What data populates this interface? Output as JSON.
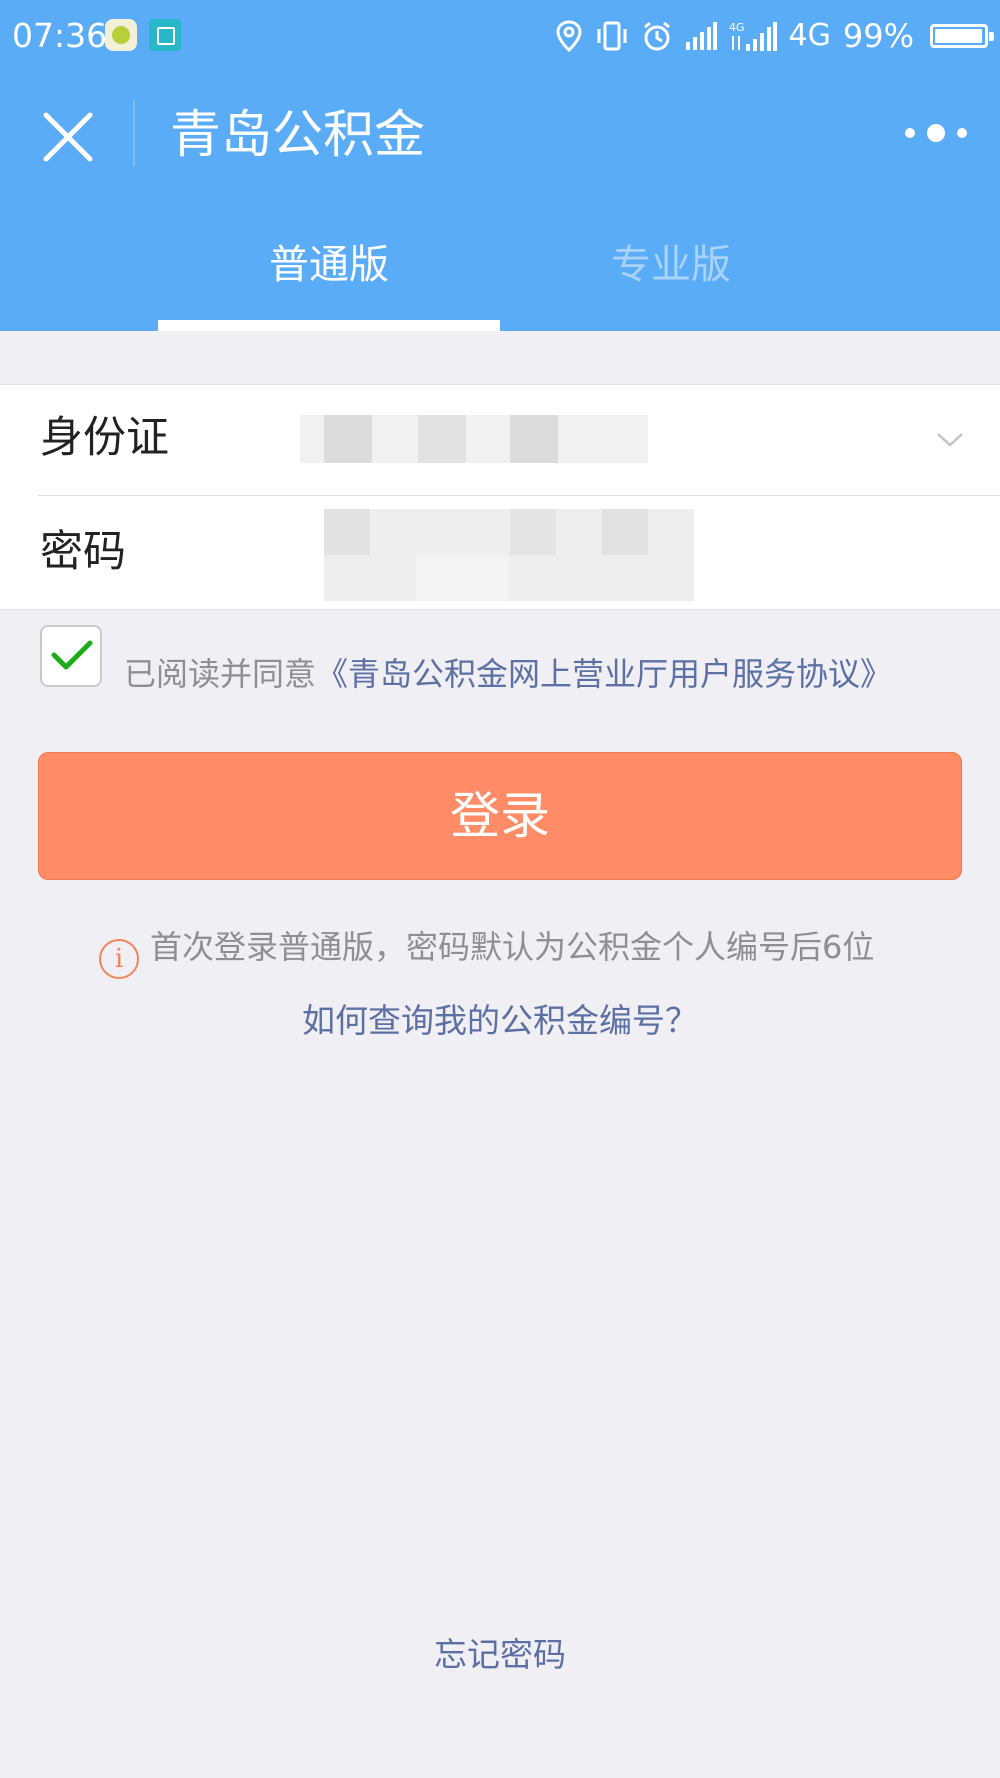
{
  "status_bar": {
    "time": "07:36",
    "network_label": "4G",
    "battery": "99%",
    "battery_level": 0.99,
    "icons": [
      "app-notification-icon",
      "screenshot-icon",
      "location-icon",
      "vibrate-icon",
      "alarm-icon",
      "signal-icon",
      "signal-4g-icon",
      "battery-icon"
    ]
  },
  "titlebar": {
    "title": "青岛公积金",
    "close_icon": "close-icon",
    "more_icon": "more-icon"
  },
  "tabs": [
    {
      "label": "普通版",
      "active": true
    },
    {
      "label": "专业版",
      "active": false
    }
  ],
  "form": {
    "id_label": "身份证",
    "password_label": "密码",
    "dropdown_icon": "chevron-down-icon"
  },
  "agreement": {
    "checked": true,
    "text": "已阅读并同意",
    "link": "《青岛公积金网上营业厅用户服务协议》"
  },
  "login_button": "登录",
  "hint": "首次登录普通版，密码默认为公积金个人编号后6位",
  "info_icon": "i",
  "query_link": "如何查询我的公积金编号？",
  "forgot_link": "忘记密码",
  "colors": {
    "header_bg": "#5aacf7",
    "page_bg": "#efeff4",
    "login_button": "#ff8c66",
    "link": "#5d70a3",
    "checkmark": "#1aad19",
    "info_icon": "#f4845d"
  }
}
